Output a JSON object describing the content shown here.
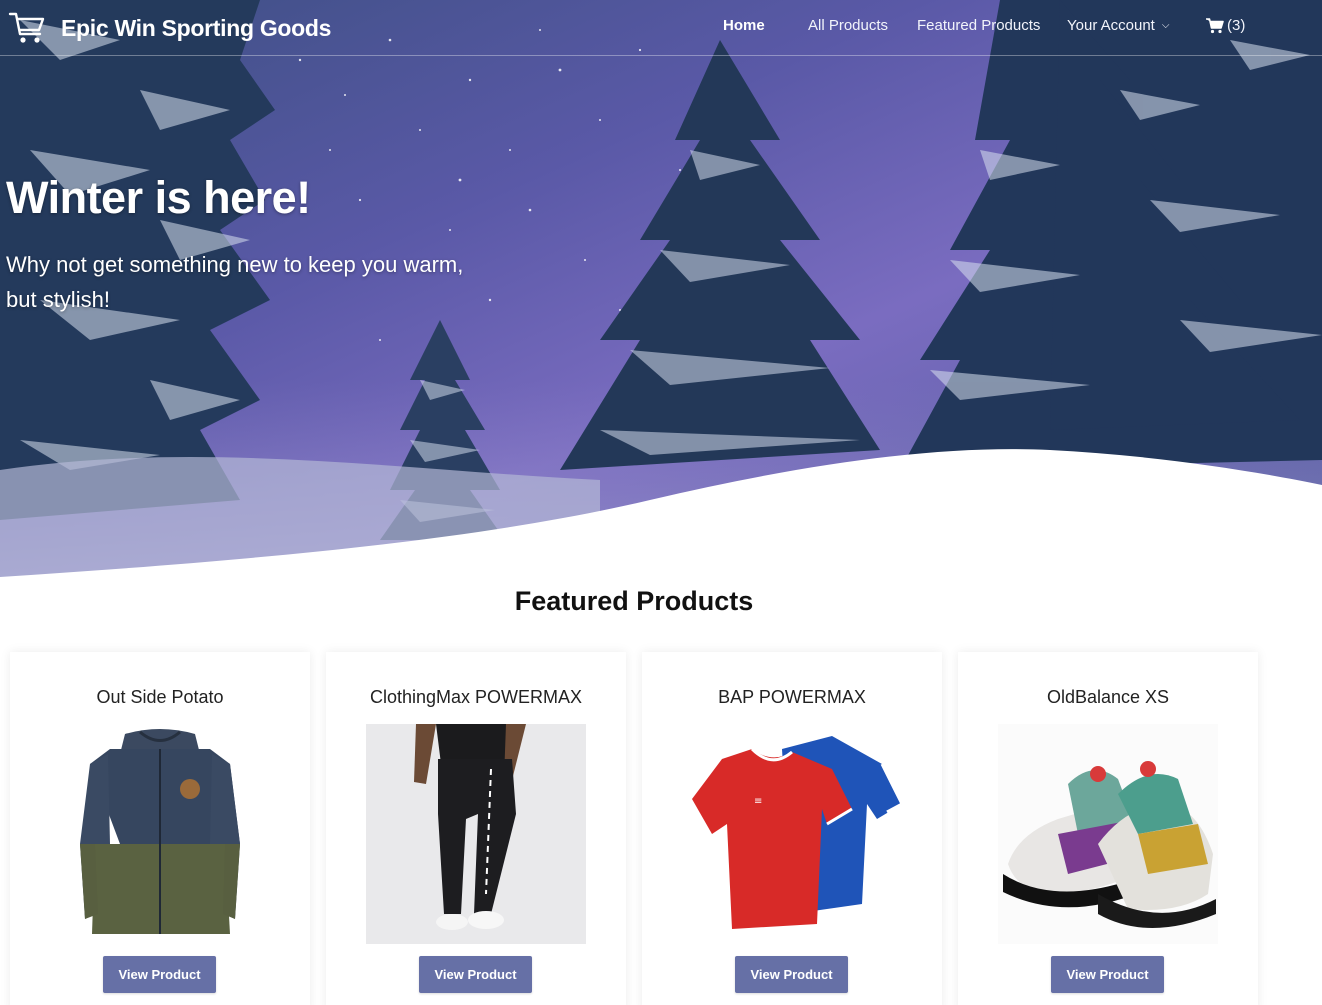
{
  "brand": {
    "name": "Epic Win Sporting Goods",
    "logo_icon": "shopping-cart-icon"
  },
  "nav": {
    "home": "Home",
    "all_products": "All Products",
    "featured_products": "Featured Products",
    "account": "Your Account",
    "cart_count": "(3)"
  },
  "hero": {
    "title": "Winter is here!",
    "subtitle": "Why not get something new to keep you warm, but stylish!"
  },
  "featured": {
    "heading": "Featured Products",
    "products": [
      {
        "name": "Out Side Potato",
        "button": "View Product",
        "image": "jacket"
      },
      {
        "name": "ClothingMax POWERMAX",
        "button": "View Product",
        "image": "track-pants"
      },
      {
        "name": "BAP POWERMAX",
        "button": "View Product",
        "image": "jerseys"
      },
      {
        "name": "OldBalance XS",
        "button": "View Product",
        "image": "sneakers"
      }
    ]
  },
  "colors": {
    "button": "#6670a6",
    "hero_sky": "#5d5aa8"
  }
}
